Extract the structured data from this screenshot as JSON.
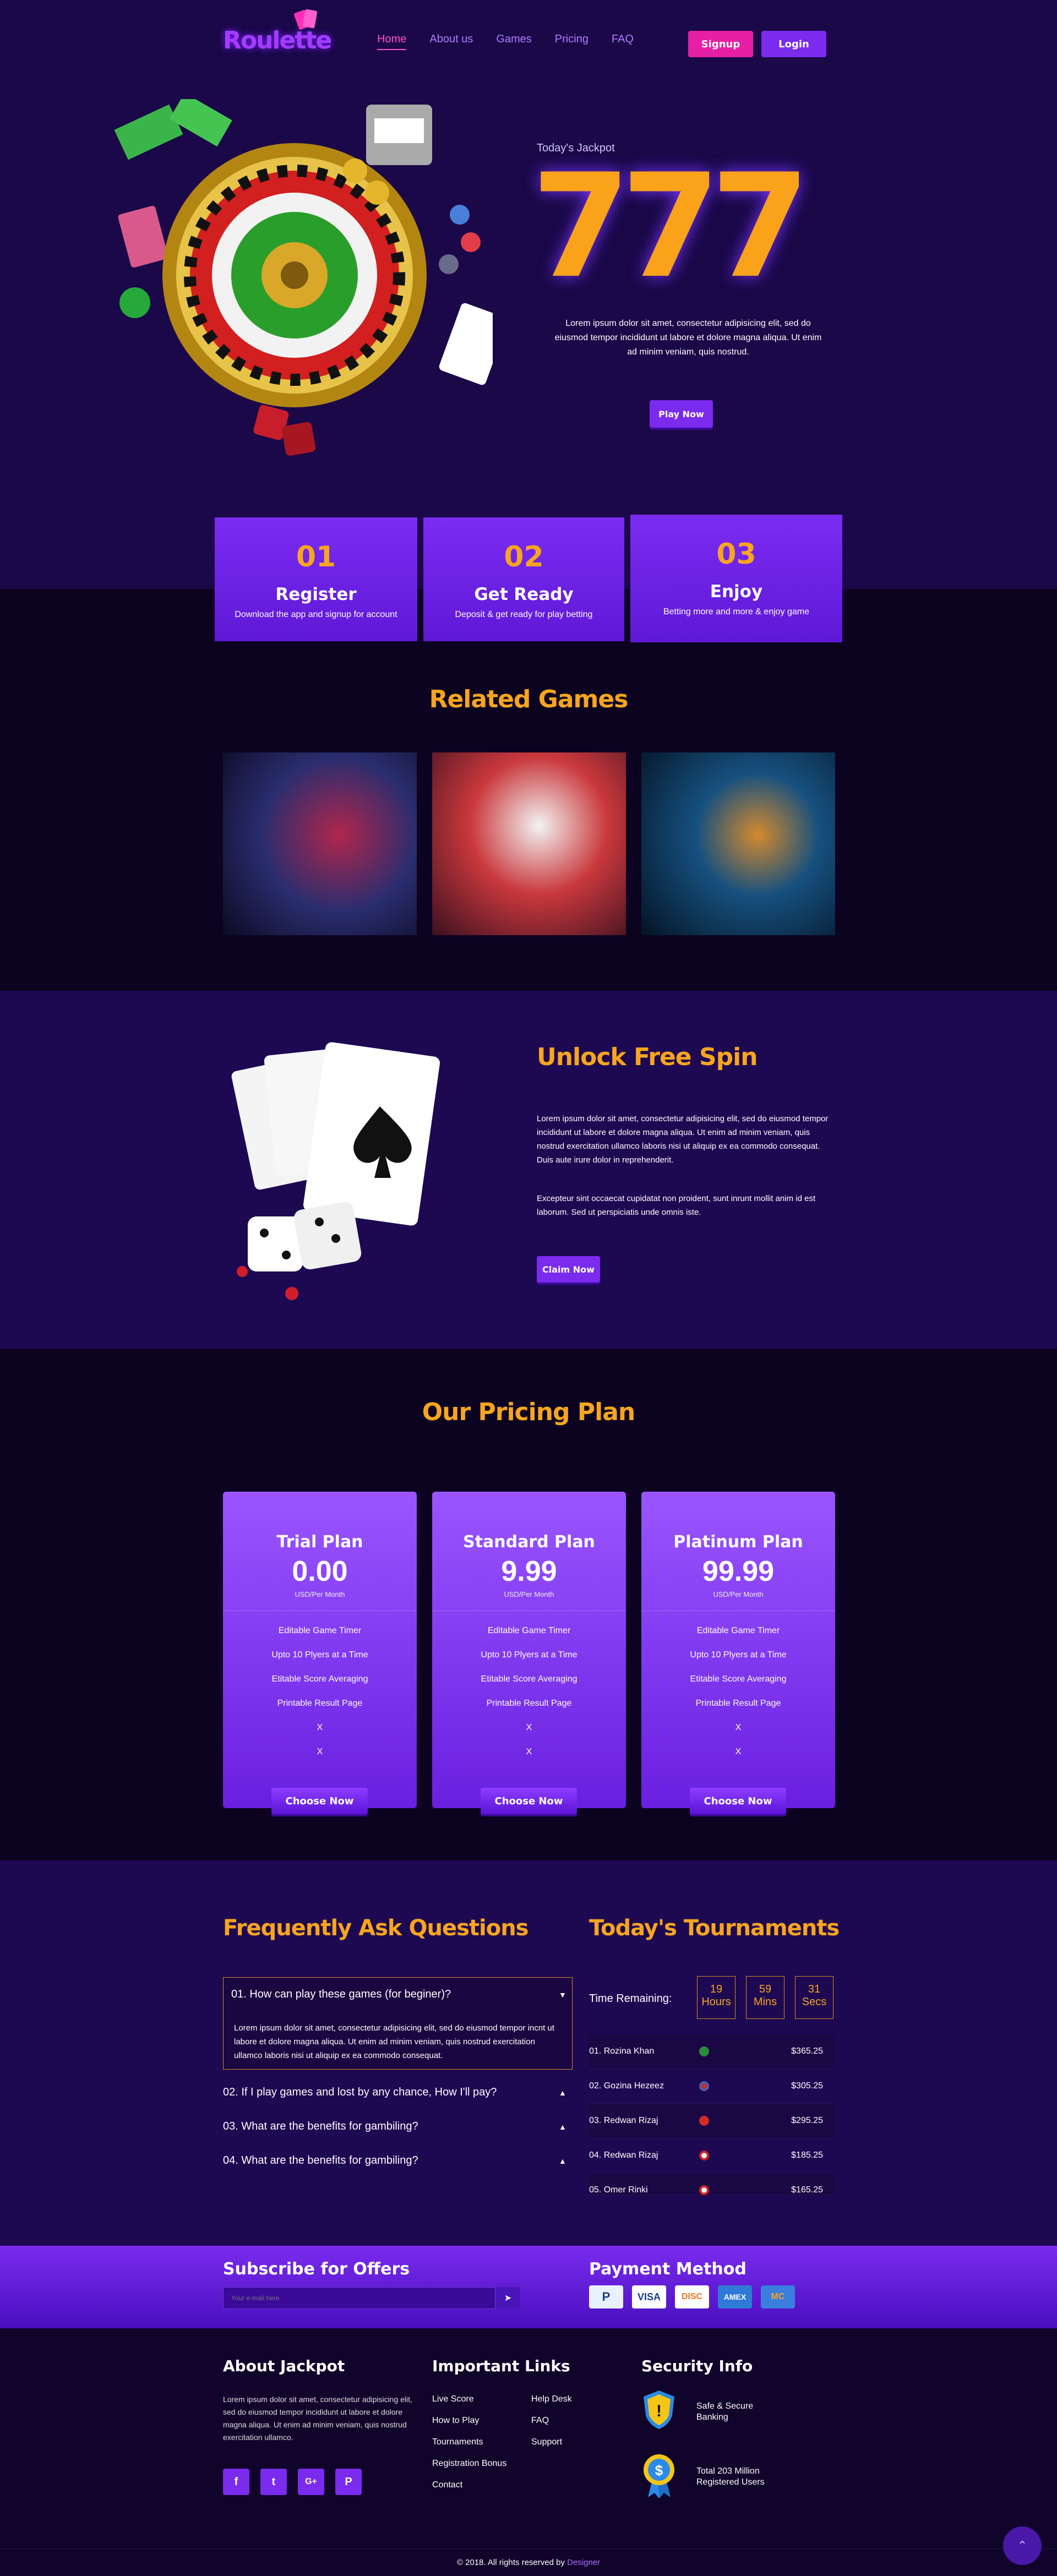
{
  "header": {
    "logo": "Roulette",
    "nav": [
      "Home",
      "About us",
      "Games",
      "Pricing",
      "FAQ"
    ],
    "signup": "Signup",
    "login": "Login"
  },
  "hero": {
    "label": "Today's Jackpot",
    "jackpot": "777",
    "text": "Lorem ipsum dolor sit amet, consectetur adipisicing elit, sed do eiusmod tempor incididunt ut labore et dolore magna aliqua. Ut enim ad minim veniam, quis nostrud.",
    "play": "Play Now"
  },
  "steps": [
    {
      "num": "01",
      "title": "Register",
      "desc": "Download the app and signup for account"
    },
    {
      "num": "02",
      "title": "Get Ready",
      "desc": "Deposit & get ready for play betting"
    },
    {
      "num": "03",
      "title": "Enjoy",
      "desc": "Betting more and more & enjoy game"
    }
  ],
  "games": {
    "title": "Related Games"
  },
  "spin": {
    "title": "Unlock Free Spin",
    "p1": "Lorem ipsum dolor sit amet, consectetur adipisicing elit, sed do eiusmod tempor incididunt ut labore et dolore magna aliqua. Ut enim ad minim veniam, quis nostrud exercitation ullamco laboris nisi ut aliquip ex ea commodo consequat. Duis aute irure dolor in reprehenderit.",
    "p2": "Excepteur sint occaecat cupidatat non proident, sunt inrunt mollit anim id est laborum. Sed ut perspiciatis unde omnis iste.",
    "claim": "Claim Now"
  },
  "pricing": {
    "title": "Our Pricing Plan",
    "plans": [
      {
        "name": "Trial Plan",
        "price": "0.00",
        "per": "USD/Per Month",
        "features": [
          "Editable Game Timer",
          "Upto 10 Plyers at a Time",
          "Etitable Score Averaging",
          "Printable Result Page",
          "X",
          "X"
        ],
        "btn": "Choose Now"
      },
      {
        "name": "Standard Plan",
        "price": "9.99",
        "per": "USD/Per Month",
        "features": [
          "Editable Game Timer",
          "Upto 10 Plyers at a Time",
          "Etitable Score Averaging",
          "Printable Result Page",
          "X",
          "X"
        ],
        "btn": "Choose Now"
      },
      {
        "name": "Platinum Plan",
        "price": "99.99",
        "per": "USD/Per Month",
        "features": [
          "Editable Game Timer",
          "Upto 10 Plyers at a Time",
          "Etitable Score Averaging",
          "Printable Result Page",
          "X",
          "X"
        ],
        "btn": "Choose Now"
      }
    ]
  },
  "faq": {
    "title": "Frequently Ask Questions",
    "items": [
      {
        "q": "01. How can play these games (for beginer)?",
        "a": "Lorem ipsum dolor sit amet, consectetur adipisicing elit, sed do eiusmod tempor incnt ut labore et dolore magna aliqua. Ut enim ad minim veniam, quis nostrud exercitation ullamco laboris nisi ut aliquip ex ea commodo consequat."
      },
      {
        "q": "02. If I play games and lost by any chance, How I'll pay?"
      },
      {
        "q": "03. What are the benefits for gambiling?"
      },
      {
        "q": "04. What are the benefits for gambiling?"
      }
    ]
  },
  "tournaments": {
    "title": "Today's Tournaments",
    "remaining": "Time Remaining:",
    "timer": [
      {
        "v": "19",
        "u": "Hours"
      },
      {
        "v": "59",
        "u": "Mins"
      },
      {
        "v": "31",
        "u": "Secs"
      }
    ],
    "rows": [
      {
        "name": "01. Rozina Khan",
        "amount": "$365.25"
      },
      {
        "name": "02. Gozina Hezeez",
        "amount": "$305.25"
      },
      {
        "name": "03. Redwan Rizaj",
        "amount": "$295.25"
      },
      {
        "name": "04. Redwan Rizaj",
        "amount": "$185.25"
      },
      {
        "name": "05. Omer Rinki",
        "amount": "$165.25"
      }
    ]
  },
  "subscribe": {
    "title": "Subscribe for Offers",
    "placeholder": "Your e-mail here"
  },
  "payment": {
    "title": "Payment Method",
    "cards": [
      "P",
      "VISA",
      "DISC",
      "AMEX",
      "MC"
    ]
  },
  "footer": {
    "about_title": "About Jackpot",
    "about_text": "Lorem ipsum dolor sit amet, consectetur adipisicing elit, sed do eiusmod tempor incididunt ut labore et dolore magna aliqua. Ut enim ad minim veniam, quis nostrud exercitation ullamco.",
    "social": [
      "f",
      "t",
      "G+",
      "P"
    ],
    "links_title": "Important Links",
    "links_col1": [
      "Live Score",
      "How to Play",
      "Tournaments",
      "Registration Bonus",
      "Contact"
    ],
    "links_col2": [
      "Help Desk",
      "FAQ",
      "Support"
    ],
    "security_title": "Security Info",
    "sec1": "Safe & Secure Banking",
    "sec2": "Total 203 Million Registered Users",
    "copy": "© 2018. All rights reserved by",
    "designer": "Designer"
  }
}
